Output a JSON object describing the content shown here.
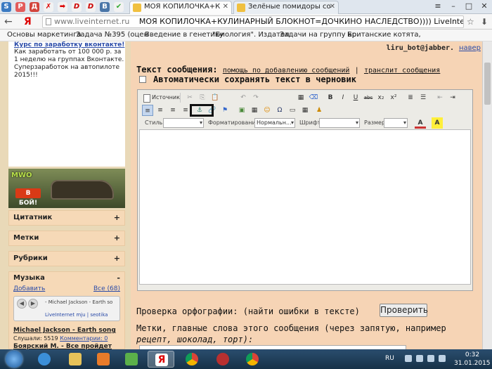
{
  "browser": {
    "tabs": [
      {
        "label": "МОЯ КОПИЛОЧКА+К",
        "active": true
      },
      {
        "label": "Зелёные помидоры со",
        "active": false
      }
    ],
    "pinned_icons": [
      "S",
      "P",
      "Д",
      "✗",
      "➡",
      "D",
      "D",
      "B",
      "✔"
    ],
    "window_controls": {
      "menu": "≡",
      "minimize": "–",
      "maximize": "□",
      "close": "✕"
    },
    "back": "←",
    "yandex": "Я",
    "url_host": "www.liveinternet.ru",
    "url_title": "МОЯ КОПИЛОЧКА+КУЛИНАРНЫЙ БЛОКНОТ=ДОЧКИНО НАСЛЕДСТВО)))) LiveInternet - Рос",
    "star": "☆",
    "download": "⬇",
    "bookmarks": [
      "Основы маркетинга",
      "Задача №395 (оцен",
      "Введение в генетику",
      "\"Биология\". Издател",
      "Задачи на группу кр",
      "Британские котята,"
    ]
  },
  "sidebar": {
    "ad_link": "Курс по заработку вконтакте!",
    "ad_text": "Как заработать от 100 000 р. за 1 неделю на группах Вконтакте. Суперзаработок на автопилоте 2015!!!",
    "banner_logo": "MWO",
    "banner_button": "В БОЙ!",
    "sections": [
      {
        "label": "Цитатник",
        "toggle": "+"
      },
      {
        "label": "Метки",
        "toggle": "+"
      },
      {
        "label": "Рубрики",
        "toggle": "+"
      }
    ],
    "music": {
      "label": "Музыка",
      "toggle": "-",
      "add": "Добавить",
      "all": "Все (68)",
      "player_title": "- Michael Jackson - Earth so",
      "player_footer": "LiveInternet    mju | seotika",
      "song": "Michael Jackson - Earth song",
      "listens": "Слушали: 5519",
      "comments": "Комментарии: 0",
      "song2": "Боярский М. - Все пройдет"
    }
  },
  "main": {
    "jabber": "liru_bot@jabber.",
    "jabber_more": "навер",
    "msg_label": "Текст сообщения:",
    "help_link": "помощь по добавлению сообщений",
    "separator": "|",
    "translit_link": "транслит сообщения",
    "autosave_label": "Автоматически сохранять текст в черновик",
    "editor": {
      "source_label": "Источник",
      "row1_icons": [
        "✂",
        "⎘",
        "📋",
        "↶",
        "↷",
        "▦",
        "⌫",
        "B",
        "I",
        "U",
        "abc",
        "x₂",
        "x²",
        "≣",
        "☰",
        "⇤",
        "⇥"
      ],
      "row2_icons": [
        "≡",
        "≡",
        "≡",
        "≡",
        "⚓",
        "🔗",
        "⚑",
        "▣",
        "▦",
        "☺",
        "Ω",
        "▭",
        "▦",
        "♟"
      ],
      "style_label": "Стиль",
      "format_label": "Форматирование",
      "format_value": "Нормальн...",
      "font_label": "Шрифт",
      "size_label": "Размер",
      "text_color": "A",
      "bg_color": "A"
    },
    "spell_label": "Проверка орфографии: (найти ошибки в тексте)",
    "check_button": "Проверить",
    "tags_label": "Метки, главные слова этого сообщения (через запятую, например",
    "tags_example": "рецепт, шоколад, торт):"
  },
  "taskbar": {
    "lang": "RU",
    "time": "0:32",
    "date": "31.01.2015"
  },
  "colors": {
    "accent": "#2a4ba8",
    "sidebar_section": "#f6d9b7",
    "main_bg": "#f6d4b5"
  }
}
